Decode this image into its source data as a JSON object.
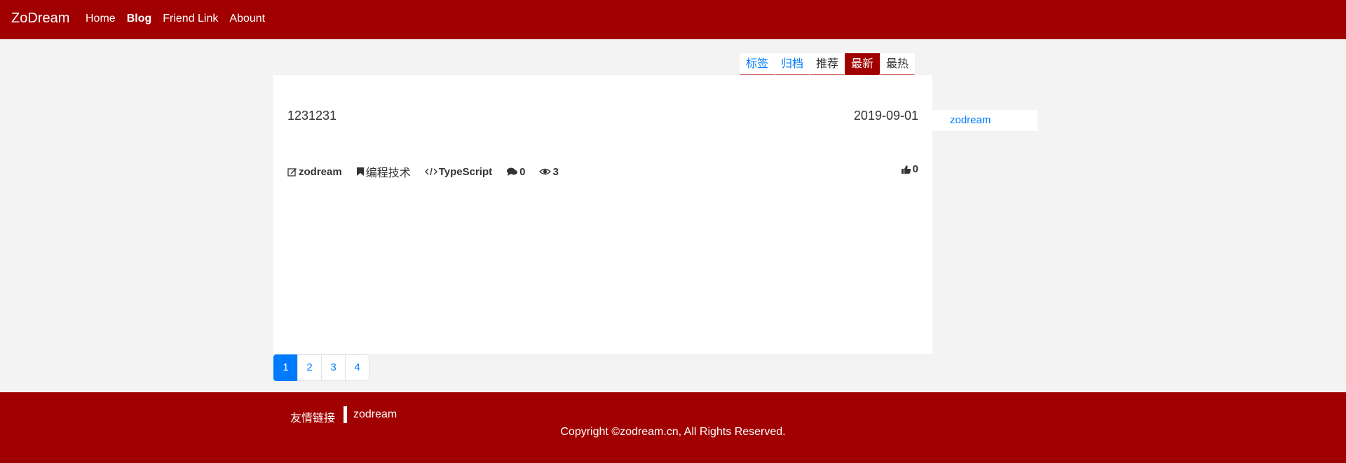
{
  "header": {
    "brand": "ZoDream",
    "nav": [
      {
        "label": "Home"
      },
      {
        "label": "Blog",
        "active": true
      },
      {
        "label": "Friend Link"
      },
      {
        "label": "Abount"
      }
    ]
  },
  "tabs": [
    {
      "label": "标签"
    },
    {
      "label": "归档"
    },
    {
      "label": "推荐"
    },
    {
      "label": "最新",
      "active": true
    },
    {
      "label": "最热"
    }
  ],
  "post": {
    "title": "1231231",
    "date": "2019-09-01",
    "author": "zodream",
    "category": "编程技术",
    "language": "TypeScript",
    "comments": "0",
    "views": "3",
    "likes": "0"
  },
  "sidebar": {
    "link": "zodream"
  },
  "pagination": {
    "pages": [
      "1",
      "2",
      "3",
      "4"
    ],
    "current": "1"
  },
  "footer": {
    "friend_label": "友情链接",
    "friend_link": "zodream",
    "copyright": "Copyright ©zodream.cn, All Rights Reserved."
  },
  "colors": {
    "brand": "#a10000",
    "arrow": "#cd6565",
    "link": "#007bff"
  }
}
